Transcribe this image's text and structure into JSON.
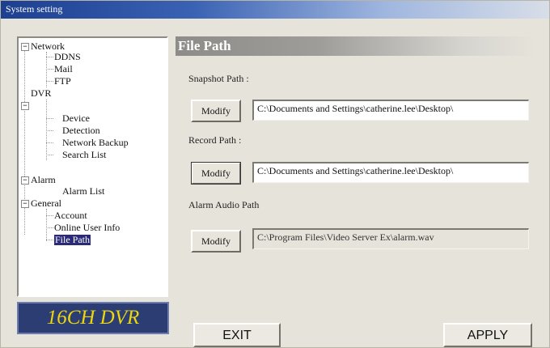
{
  "window": {
    "title": "System setting"
  },
  "tree": {
    "network": "Network",
    "ddns": "DDNS",
    "mail": "Mail",
    "ftp": "FTP",
    "dvr": "DVR",
    "device": "Device",
    "detection": "Detection",
    "network_backup": "Network Backup",
    "search_list": "Search List",
    "alarm": "Alarm",
    "alarm_list": "Alarm List",
    "general": "General",
    "account": "Account",
    "online_user_info": "Online User Info",
    "file_path": "File Path",
    "expander_symbol": "−"
  },
  "brand": {
    "label": "16CH DVR"
  },
  "panel": {
    "title": "File Path",
    "snapshot_label": "Snapshot Path :",
    "snapshot_value": "C:\\Documents and Settings\\catherine.lee\\Desktop\\",
    "record_label": "Record Path :",
    "record_value": "C:\\Documents and Settings\\catherine.lee\\Desktop\\",
    "alarm_label": "Alarm Audio Path",
    "alarm_value": "C:\\Program Files\\Video Server Ex\\alarm.wav",
    "modify_label": "Modify"
  },
  "footer": {
    "exit_label": "EXIT",
    "apply_label": "APPLY"
  },
  "colors": {
    "title_bar": "#1d3f8f",
    "selection": "#2a2a78",
    "brand_bg": "#2c3d74",
    "brand_text": "#ecd70d"
  }
}
